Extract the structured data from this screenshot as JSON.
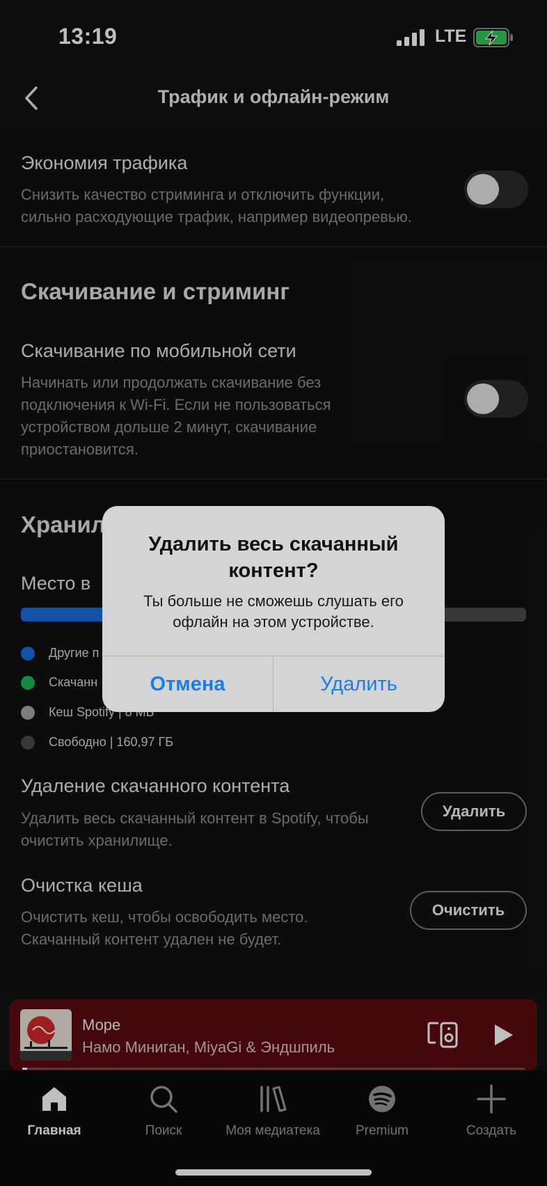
{
  "status_bar": {
    "time": "13:19",
    "network": "LTE"
  },
  "header": {
    "title": "Трафик и офлайн-режим"
  },
  "data_saver": {
    "title": "Экономия трафика",
    "description_lines": [
      "Снизить качество стриминга и отключить функции,",
      "сильно расходующие трафик, например видеопревью."
    ],
    "enabled": false
  },
  "download_section": {
    "title": "Скачивание и стриминг",
    "cellular": {
      "title": "Скачивание по мобильной сети",
      "description_lines": [
        "Начинать или продолжать скачивание без",
        "подключения к Wi-Fi. Если не пользоваться",
        "устройством дольше 2 минут, скачивание",
        "приостановится."
      ],
      "enabled": false
    }
  },
  "storage_section": {
    "title": "Хранил",
    "space_label": "Место в",
    "bar_used_fraction": 0.31,
    "legend": [
      {
        "label": "Другие п",
        "color": "#1a6be0"
      },
      {
        "label": "Скачанн",
        "color": "#1db954"
      },
      {
        "label": "Кеш Spotify | 8 МБ",
        "color": "#a6a6a6"
      },
      {
        "label": "Свободно | 160,97 ГБ",
        "color": "#4a4a4a"
      }
    ],
    "remove_downloads": {
      "title": "Удаление скачанного контента",
      "description_lines": [
        "Удалить весь скачанный контент в Spotify, чтобы",
        "очистить хранилище."
      ],
      "button_label": "Удалить"
    },
    "clear_cache": {
      "title": "Очистка кеша",
      "description_lines": [
        "Очистить кеш, чтобы освободить место.",
        "Скачанный контент удален не будет."
      ],
      "button_label": "Очистить"
    }
  },
  "dialog": {
    "title_lines": [
      "Удалить весь скачанный",
      "контент?"
    ],
    "message_lines": [
      "Ты больше не сможешь слушать его",
      "офлайн на этом устройстве."
    ],
    "cancel_label": "Отмена",
    "confirm_label": "Удалить"
  },
  "mini_player": {
    "title": "Море",
    "artist": "Намо Миниган, MiyaGi & Эндшпиль",
    "progress_fraction": 0.01
  },
  "tab_bar": {
    "tabs": [
      {
        "label": "Главная",
        "icon": "home-icon",
        "active": true
      },
      {
        "label": "Поиск",
        "icon": "search-icon",
        "active": false
      },
      {
        "label": "Моя медиатека",
        "icon": "library-icon",
        "active": false
      },
      {
        "label": "Premium",
        "icon": "spotify-icon",
        "active": false
      },
      {
        "label": "Создать",
        "icon": "plus-icon",
        "active": false
      }
    ]
  }
}
